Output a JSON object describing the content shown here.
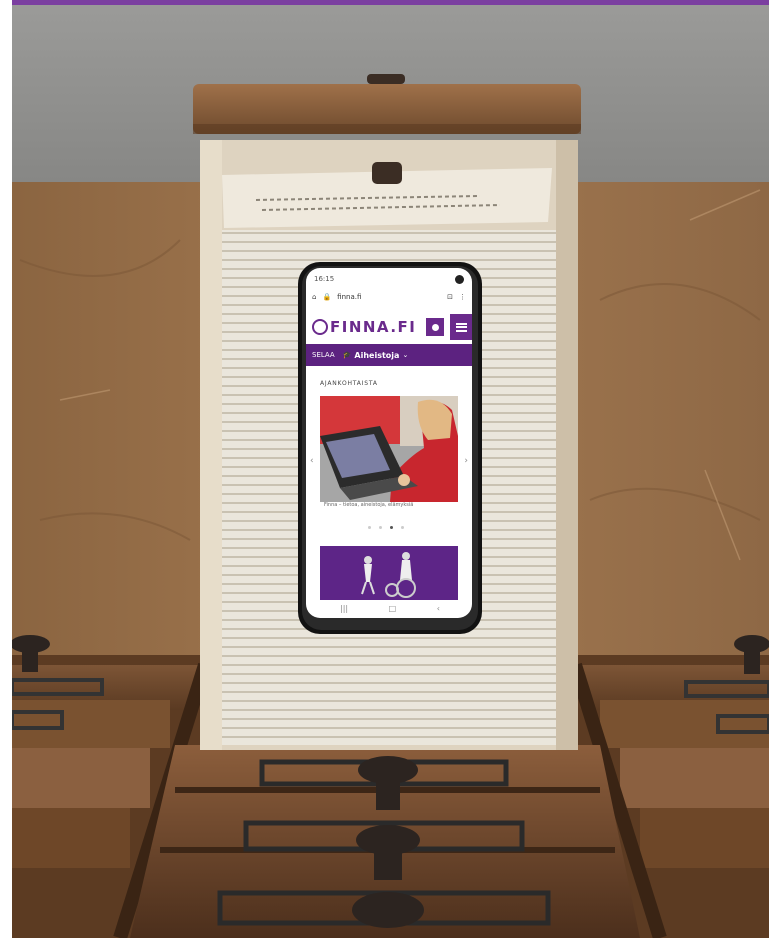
{
  "colors": {
    "brand_purple": "#6a2a8c",
    "nav_purple": "#5c2280",
    "top_border": "#7b3fa0"
  },
  "phone": {
    "status_time": "16:15",
    "url": "finna.fi",
    "logo_text": "FINNA.FI",
    "nav": {
      "browse_label": "SELAA",
      "topic_label": "Aiheistoja"
    },
    "section_title": "AJANKOHTAISTA",
    "caption": "Finna – tietoa, aineistoja, elämyksiä",
    "carousel_dots": 4,
    "carousel_active_index": 2
  },
  "icons": {
    "home": "home-icon",
    "lock": "lock-icon",
    "user": "user-icon",
    "menu": "menu-icon",
    "tabs": "tabs-icon",
    "more": "more-vert-icon"
  }
}
